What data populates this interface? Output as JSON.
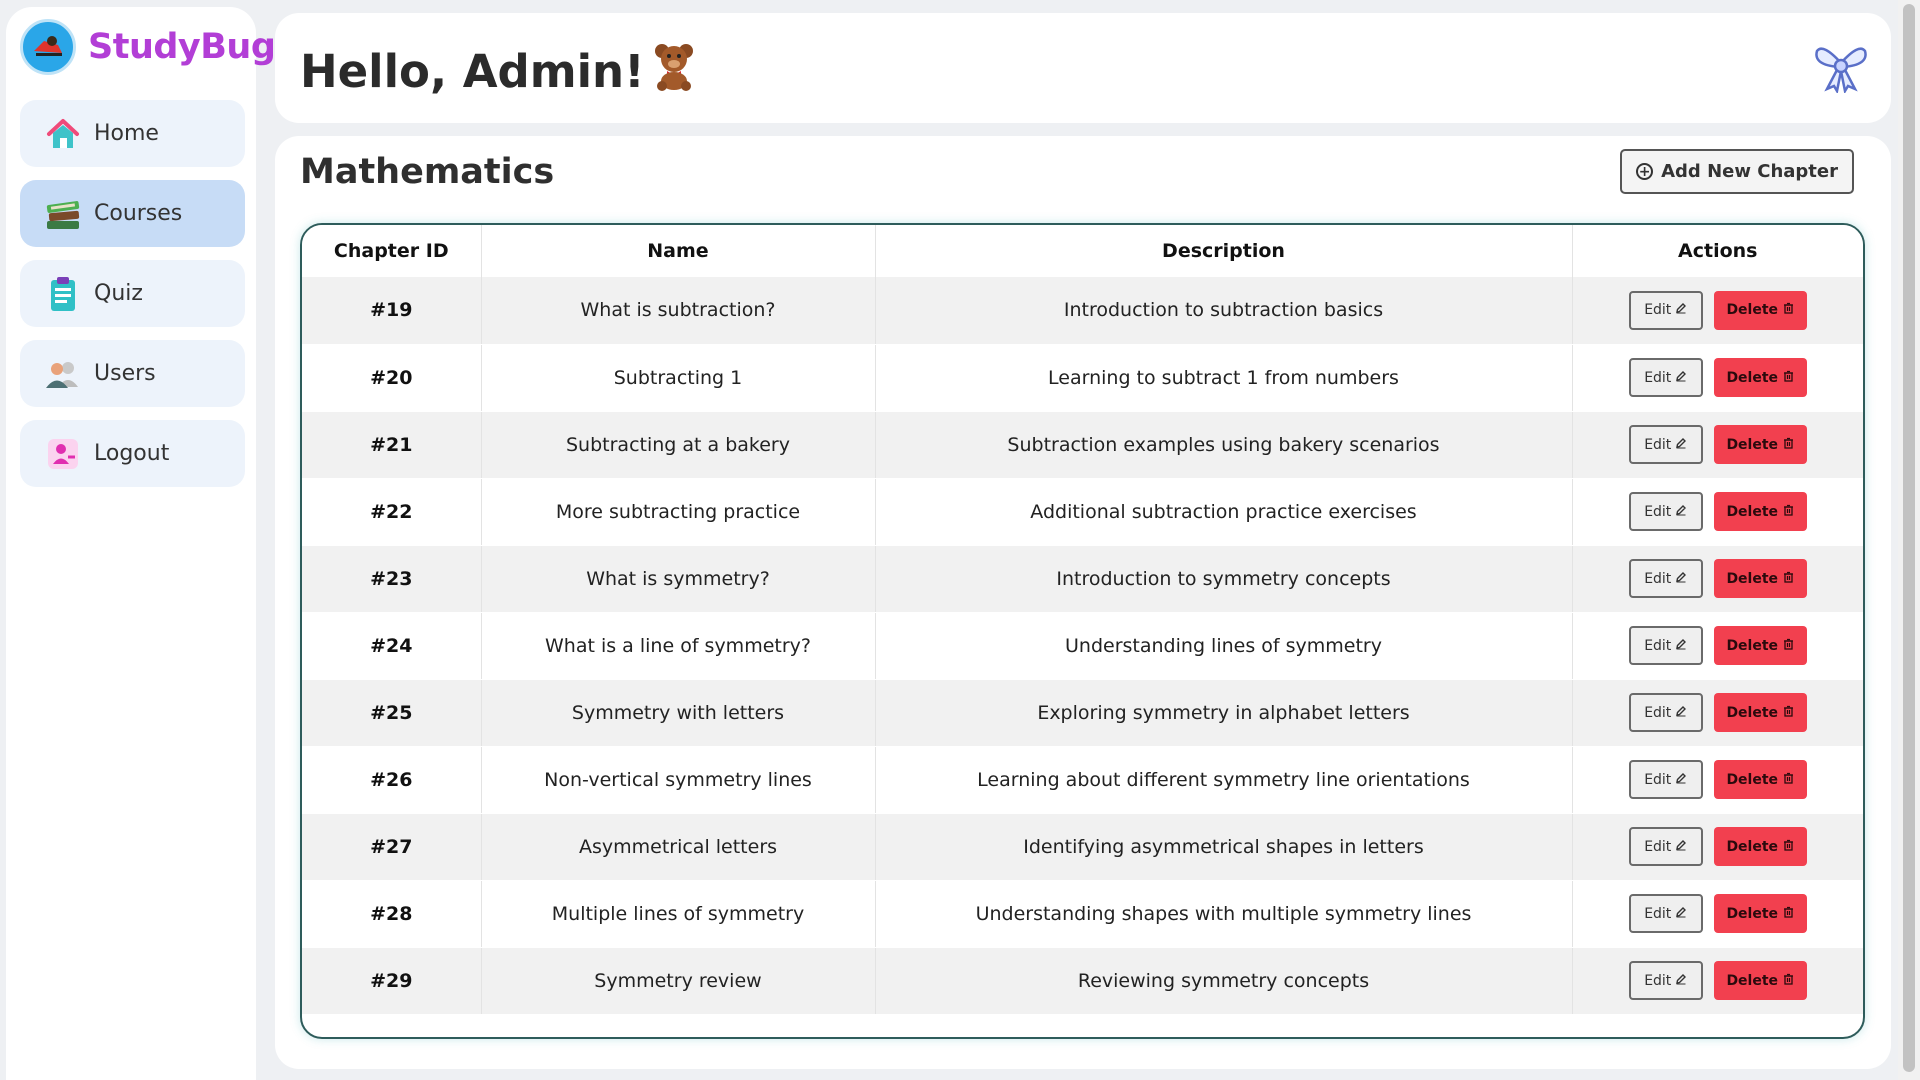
{
  "brand": {
    "name": "StudyBug"
  },
  "sidebar": {
    "items": [
      {
        "label": "Home",
        "icon": "house-icon"
      },
      {
        "label": "Courses",
        "icon": "books-icon",
        "active": true
      },
      {
        "label": "Quiz",
        "icon": "clipboard-icon"
      },
      {
        "label": "Users",
        "icon": "users-icon"
      },
      {
        "label": "Logout",
        "icon": "logout-icon"
      }
    ]
  },
  "header": {
    "greeting": "Hello, Admin!",
    "greeting_emoji_icon": "teddy-bear-icon",
    "decoration_icon": "bow-icon"
  },
  "main": {
    "course_title": "Mathematics",
    "add_button_label": "Add New Chapter",
    "table": {
      "columns": [
        "Chapter ID",
        "Name",
        "Description",
        "Actions"
      ],
      "edit_label": "Edit",
      "delete_label": "Delete",
      "rows": [
        {
          "id": "#19",
          "name": "What is subtraction?",
          "description": "Introduction to subtraction basics"
        },
        {
          "id": "#20",
          "name": "Subtracting 1",
          "description": "Learning to subtract 1 from numbers"
        },
        {
          "id": "#21",
          "name": "Subtracting at a bakery",
          "description": "Subtraction examples using bakery scenarios"
        },
        {
          "id": "#22",
          "name": "More subtracting practice",
          "description": "Additional subtraction practice exercises"
        },
        {
          "id": "#23",
          "name": "What is symmetry?",
          "description": "Introduction to symmetry concepts"
        },
        {
          "id": "#24",
          "name": "What is a line of symmetry?",
          "description": "Understanding lines of symmetry"
        },
        {
          "id": "#25",
          "name": "Symmetry with letters",
          "description": "Exploring symmetry in alphabet letters"
        },
        {
          "id": "#26",
          "name": "Non-vertical symmetry lines",
          "description": "Learning about different symmetry line orientations"
        },
        {
          "id": "#27",
          "name": "Asymmetrical letters",
          "description": "Identifying asymmetrical shapes in letters"
        },
        {
          "id": "#28",
          "name": "Multiple lines of symmetry",
          "description": "Understanding shapes with multiple symmetry lines"
        },
        {
          "id": "#29",
          "name": "Symmetry review",
          "description": "Reviewing symmetry concepts"
        }
      ]
    }
  },
  "colors": {
    "brand": "#b23ed6",
    "nav_active": "#c7dcf6",
    "nav_bg": "#edf3fb",
    "delete": "#f2404f",
    "table_border": "#2e5c5b"
  }
}
